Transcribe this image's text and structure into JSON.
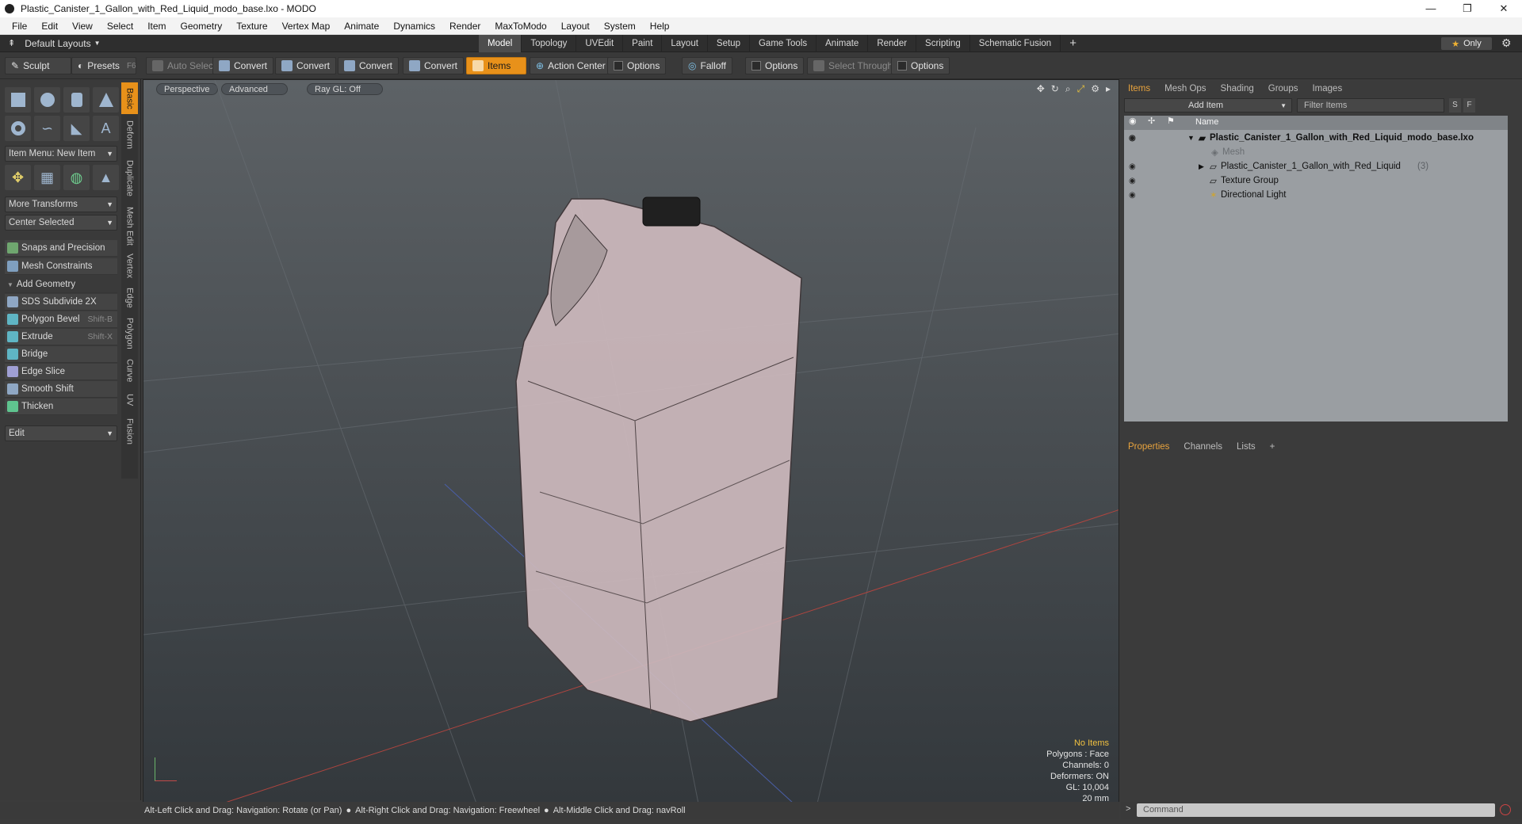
{
  "window": {
    "title": "Plastic_Canister_1_Gallon_with_Red_Liquid_modo_base.lxo - MODO",
    "minimize": "—",
    "restore": "❐",
    "close": "✕"
  },
  "menu": [
    "File",
    "Edit",
    "View",
    "Select",
    "Item",
    "Geometry",
    "Texture",
    "Vertex Map",
    "Animate",
    "Dynamics",
    "Render",
    "MaxToModo",
    "Layout",
    "System",
    "Help"
  ],
  "layoutbar": {
    "layout_label": "Default Layouts",
    "tabs": [
      "Model",
      "Topology",
      "UVEdit",
      "Paint",
      "Layout",
      "Setup",
      "Game Tools",
      "Animate",
      "Render",
      "Scripting",
      "Schematic Fusion"
    ],
    "active_tab": "Model",
    "add": "+",
    "only_label": "Only"
  },
  "toolbar": {
    "sculpt": "Sculpt",
    "presets": "Presets",
    "presets_key": "F6",
    "auto_select": "Auto Select",
    "convert1": "Convert",
    "convert2": "Convert",
    "convert3": "Convert",
    "convert4": "Convert",
    "items": "Items",
    "action_center": "Action Center",
    "options1": "Options",
    "falloff": "Falloff",
    "options2": "Options",
    "select_through": "Select Through",
    "options3": "Options"
  },
  "leftpanel": {
    "vtabs": [
      "Basic",
      "Deform",
      "Duplicate",
      "Mesh Edit",
      "Vertex",
      "Edge",
      "Polygon",
      "Curve",
      "UV",
      "Fusion"
    ],
    "item_menu": "Item Menu: New Item",
    "more_transforms": "More Transforms",
    "center_selected": "Center Selected",
    "snaps": "Snaps and Precision",
    "mesh_constraints": "Mesh Constraints",
    "add_geometry": "Add Geometry",
    "tools": [
      {
        "label": "SDS Subdivide 2X",
        "shortcut": ""
      },
      {
        "label": "Polygon Bevel",
        "shortcut": "Shift-B"
      },
      {
        "label": "Extrude",
        "shortcut": "Shift-X"
      },
      {
        "label": "Bridge",
        "shortcut": ""
      },
      {
        "label": "Edge Slice",
        "shortcut": ""
      },
      {
        "label": "Smooth Shift",
        "shortcut": ""
      },
      {
        "label": "Thicken",
        "shortcut": ""
      }
    ],
    "edit": "Edit"
  },
  "viewport": {
    "view": "Perspective",
    "mode": "Advanced",
    "raygl": "Ray GL: Off",
    "hud": {
      "no_items": "No Items",
      "polygons": "Polygons : Face",
      "channels": "Channels: 0",
      "deformers": "Deformers: ON",
      "gl": "GL: 10,004",
      "scale": "20 mm"
    }
  },
  "items_panel": {
    "tabs": [
      "Items",
      "Mesh Ops",
      "Shading",
      "Groups",
      "Images"
    ],
    "add_item": "Add Item",
    "filter": "Filter Items",
    "s_btn": "S",
    "f_btn": "F",
    "col_name": "Name",
    "rows": [
      {
        "label": "Plastic_Canister_1_Gallon_with_Red_Liquid_modo_base.lxo",
        "count": ""
      },
      {
        "label": "Mesh",
        "count": ""
      },
      {
        "label": "Plastic_Canister_1_Gallon_with_Red_Liquid",
        "count": "(3)"
      },
      {
        "label": "Texture Group",
        "count": ""
      },
      {
        "label": "Directional Light",
        "count": ""
      }
    ]
  },
  "properties_panel": {
    "tabs": [
      "Properties",
      "Channels",
      "Lists"
    ],
    "add": "+"
  },
  "statusbar": {
    "hint1": "Alt-Left Click and Drag: Navigation: Rotate (or Pan)",
    "hint2": "Alt-Right Click and Drag: Navigation: Freewheel",
    "hint3": "Alt-Middle Click and Drag: navRoll"
  },
  "command": {
    "placeholder": "Command"
  },
  "colors": {
    "accent": "#e8911a",
    "active_tab_text": "#e8a33d"
  }
}
